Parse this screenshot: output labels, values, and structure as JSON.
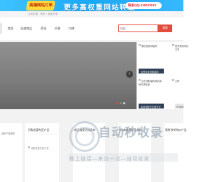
{
  "banner": {
    "tag": "高端网站订单",
    "headline": "更多高权重网站转让",
    "contact": "联系QQ:415033153"
  },
  "breadcrumb": {
    "text": "当前位置：首页 > 免费分享"
  },
  "nav": {
    "items": [
      "首页",
      "全部商品",
      "资讯",
      "问答",
      "口碑"
    ]
  },
  "search": {
    "placeholder": "搜索",
    "button_label": "搜索"
  },
  "slider": {
    "arrow": "›",
    "dots": [
      {
        "active": false,
        "color": "#e24a3b"
      },
      {
        "active": true,
        "color": "#888888"
      },
      {
        "active": false,
        "color": "#cfcfcf"
      }
    ]
  },
  "right_column": {
    "item1_line": "微信免费领福利",
    "item2_line1": "更多赚钱项目",
    "item2_line2": "文章",
    "bar1": "加盟免费领取福利",
    "item3_line1": "点击领取福利网站源",
    "item3_line2": "码可体验版",
    "side1": "立即",
    "bar2": "免费领取专业版专业",
    "side2": "VIP福利"
  },
  "cards": [
    {
      "title": "",
      "img_label": "最新产品推荐"
    },
    {
      "title": "闪购优惠专区产品",
      "img_label": "闪购优惠专区产品"
    },
    {
      "title": "新品推荐活动发布",
      "img_label": ""
    },
    {
      "title": "热卖推荐新品发布",
      "img_label": ""
    },
    {
      "title": "限时秒杀特价产品",
      "img_label": ""
    }
  ],
  "watermark": {
    "title": "自动秒收录",
    "subtitle": "做上链接—来访一次—自动收录"
  }
}
